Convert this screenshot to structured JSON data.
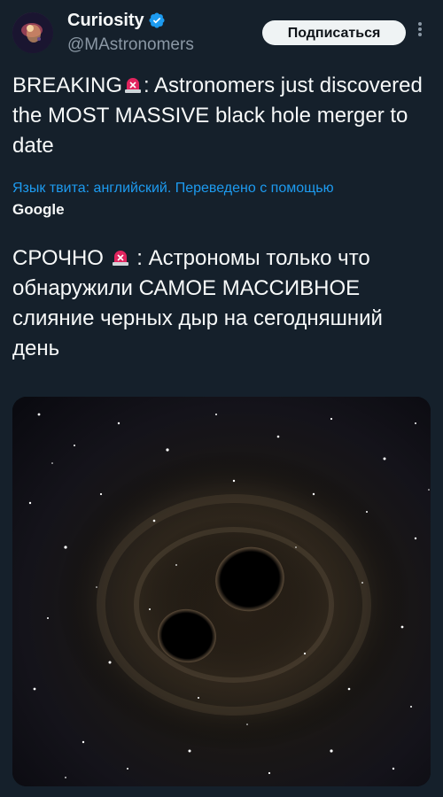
{
  "tweet": {
    "author": {
      "display_name": "Curiosity",
      "handle": "@MAstronomers",
      "avatar_icon": "galaxy-avatar",
      "verified": true
    },
    "subscribe_label": "Подписаться",
    "text_line1_prefix": "BREAKING",
    "text_line1_suffix": ": Astronomers just discovered the MOST MASSIVE black hole merger to date",
    "translation_note": "Язык твита: английский. Переведено с помощью",
    "translation_provider": "Google",
    "translated_prefix": "СРОЧНО",
    "translated_suffix": ": Астрономы только что обнаружили САМОЕ МАССИВНОЕ слияние черных дыр на сегодняшний день",
    "media_description": "black-hole-merger-image"
  },
  "colors": {
    "background": "#15202b",
    "text": "#f7f9f9",
    "secondary": "#8b98a5",
    "link": "#1d9bf0",
    "verified": "#1d9bf0",
    "siren": "#e0245e"
  }
}
